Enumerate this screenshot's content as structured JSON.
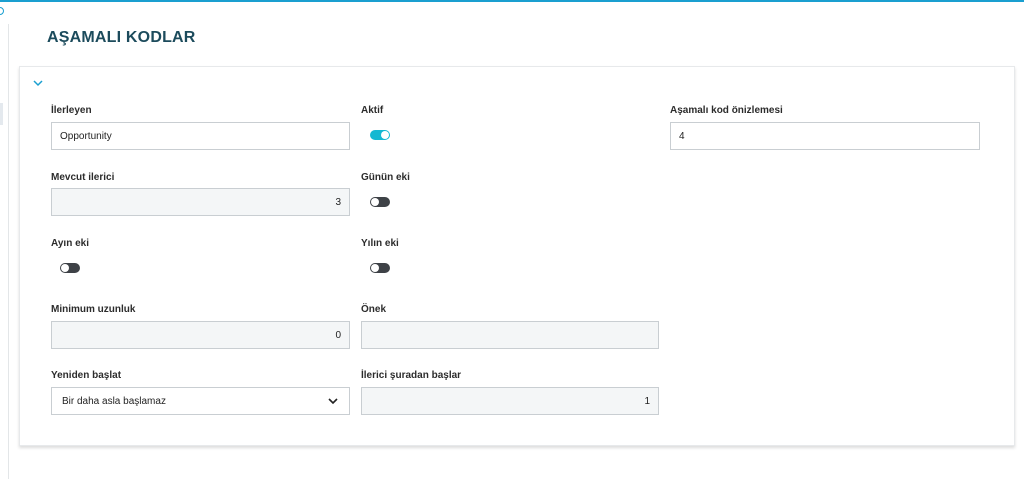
{
  "page": {
    "title": "AŞAMALI KODLAR"
  },
  "colors": {
    "accent": "#14b8d2",
    "title": "#1c4b5c",
    "toggle_off": "#3e4247"
  },
  "icons": {
    "collapse": "chevron-down-icon",
    "select": "chevron-down-icon"
  },
  "fields": {
    "ilerleyen": {
      "label": "İlerleyen",
      "value": "Opportunity"
    },
    "aktif": {
      "label": "Aktif",
      "on": true
    },
    "onizleme": {
      "label": "Aşamalı kod önizlemesi",
      "value": "4"
    },
    "mevcut": {
      "label": "Mevcut ilerici",
      "value": "3"
    },
    "gunun_eki": {
      "label": "Günün eki",
      "on": false
    },
    "ayin_eki": {
      "label": "Ayın eki",
      "on": false
    },
    "yilin_eki": {
      "label": "Yılın eki",
      "on": false
    },
    "minimum": {
      "label": "Minimum uzunluk",
      "value": "0"
    },
    "onek": {
      "label": "Önek",
      "value": ""
    },
    "yeniden": {
      "label": "Yeniden başlat",
      "value": "Bir daha asla başlamaz"
    },
    "baslangic": {
      "label": "İlerici şuradan başlar",
      "value": "1"
    }
  }
}
